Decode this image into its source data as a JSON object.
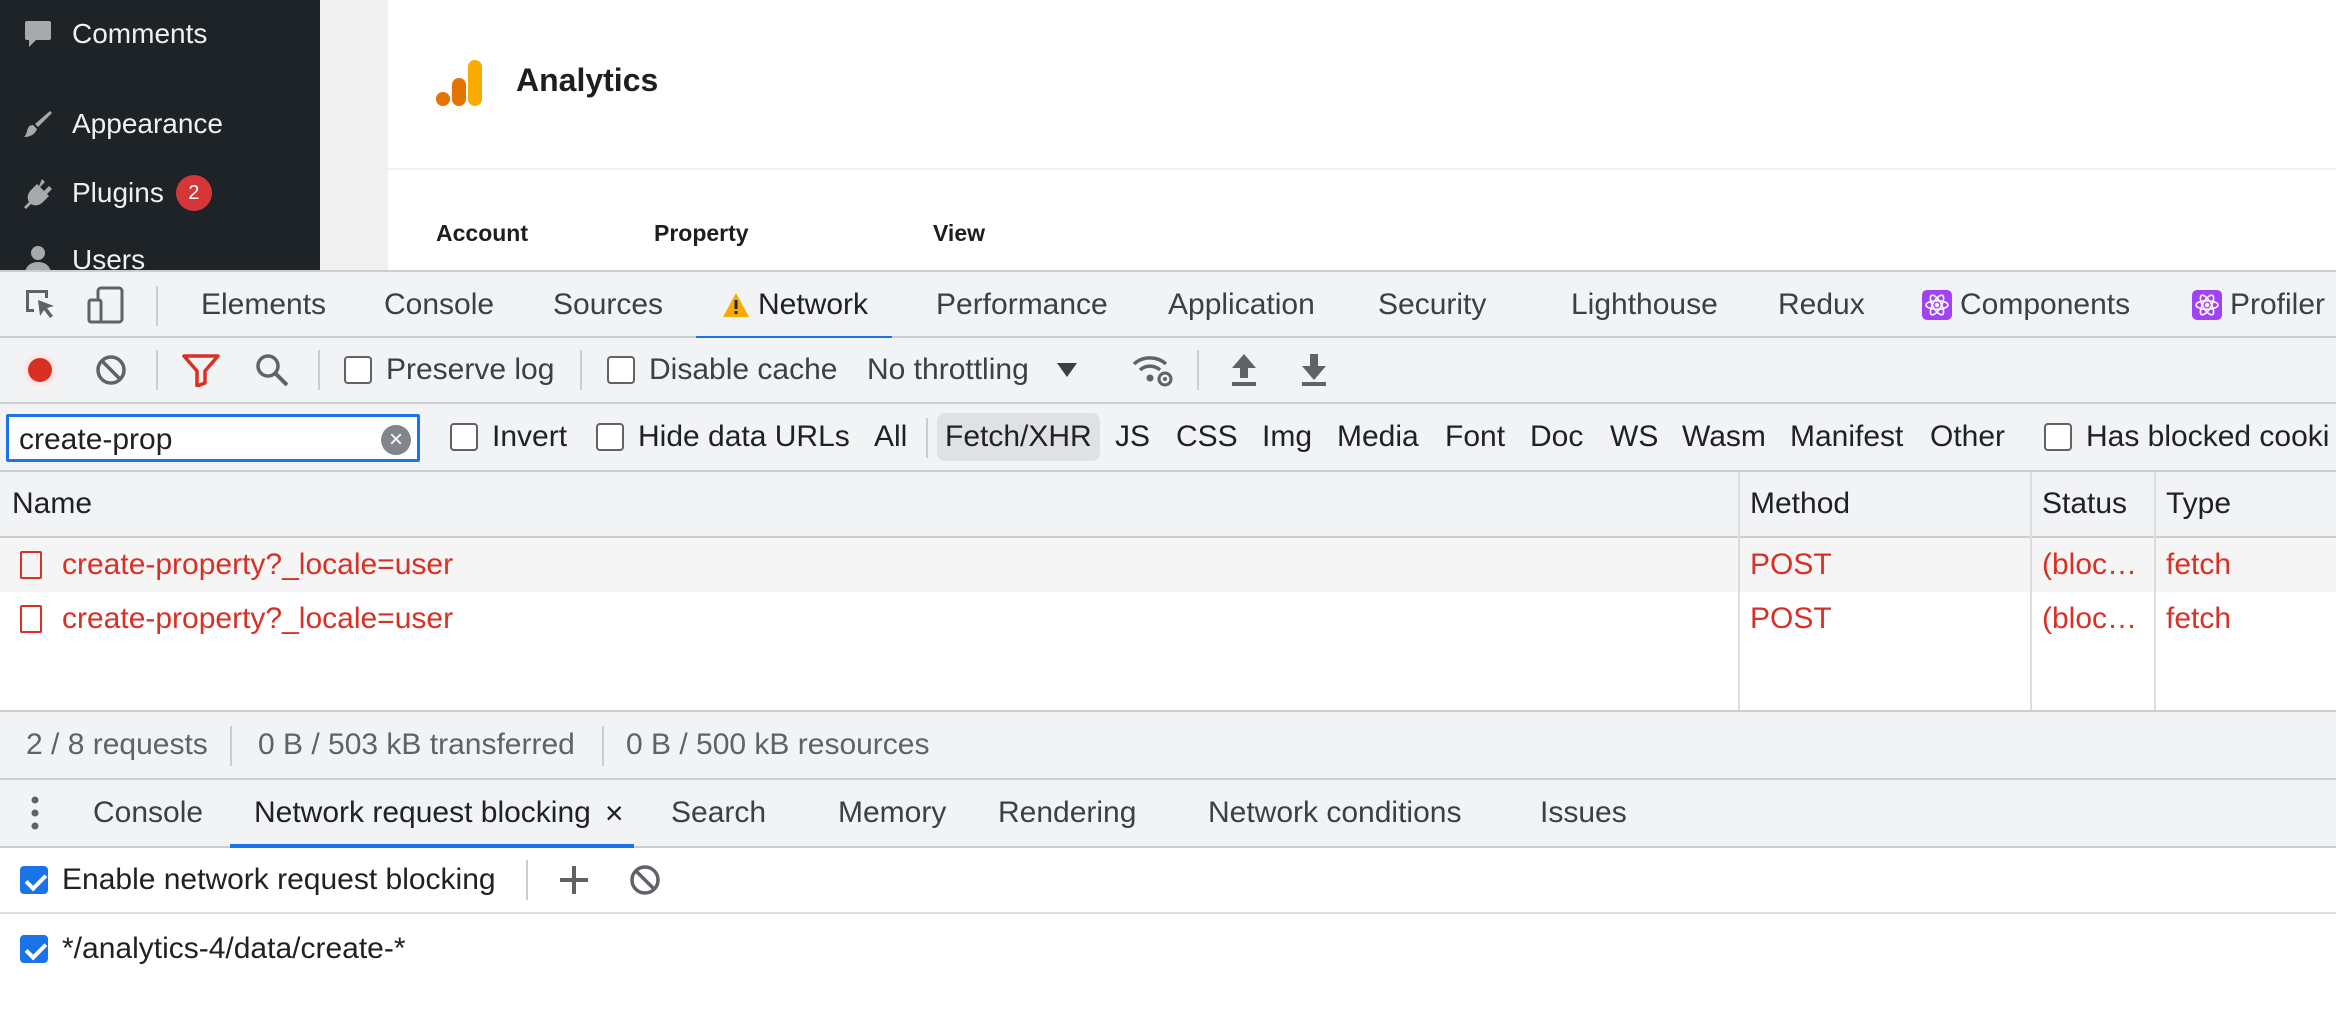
{
  "wp": {
    "sidebar": {
      "items": [
        {
          "label": "Comments",
          "icon": "comment-icon"
        },
        {
          "label": "Appearance",
          "icon": "paintbrush-icon"
        },
        {
          "label": "Plugins",
          "icon": "plugin-icon",
          "badge": "2"
        },
        {
          "label": "Users",
          "icon": "user-icon"
        }
      ]
    },
    "header": {
      "title": "Analytics",
      "logo_colors": [
        "#f9ab00",
        "#e37400"
      ]
    },
    "columns": {
      "account": "Account",
      "property": "Property",
      "view": "View"
    }
  },
  "devtools": {
    "tabs": [
      "Elements",
      "Console",
      "Sources",
      "Network",
      "Performance",
      "Application",
      "Security",
      "Lighthouse",
      "Redux",
      "Components",
      "Profiler"
    ],
    "active_tab": "Network",
    "toolbar": {
      "preserve_log": "Preserve log",
      "disable_cache": "Disable cache",
      "throttling": "No throttling"
    },
    "filter": {
      "value": "create-prop",
      "invert": "Invert",
      "hide_data_urls": "Hide data URLs",
      "types": [
        "All",
        "Fetch/XHR",
        "JS",
        "CSS",
        "Img",
        "Media",
        "Font",
        "Doc",
        "WS",
        "Wasm",
        "Manifest",
        "Other"
      ],
      "selected_type": "Fetch/XHR",
      "has_blocked_cookies": "Has blocked cooki"
    },
    "table": {
      "headers": {
        "name": "Name",
        "method": "Method",
        "status": "Status",
        "type": "Type"
      },
      "rows": [
        {
          "name": "create-property?_locale=user",
          "method": "POST",
          "status": "(bloc…",
          "type": "fetch"
        },
        {
          "name": "create-property?_locale=user",
          "method": "POST",
          "status": "(bloc…",
          "type": "fetch"
        }
      ]
    },
    "summary": {
      "requests": "2 / 8 requests",
      "transferred": "0 B / 503 kB transferred",
      "resources": "0 B / 500 kB resources"
    },
    "drawer": {
      "tabs": [
        "Console",
        "Network request blocking",
        "Search",
        "Memory",
        "Rendering",
        "Network conditions",
        "Issues"
      ],
      "active_tab": "Network request blocking",
      "enable_label": "Enable network request blocking",
      "patterns": [
        "*/analytics-4/data/create-*"
      ]
    },
    "colors": {
      "accent": "#1a73e8",
      "error": "#d93025",
      "record": "#d93025"
    }
  }
}
